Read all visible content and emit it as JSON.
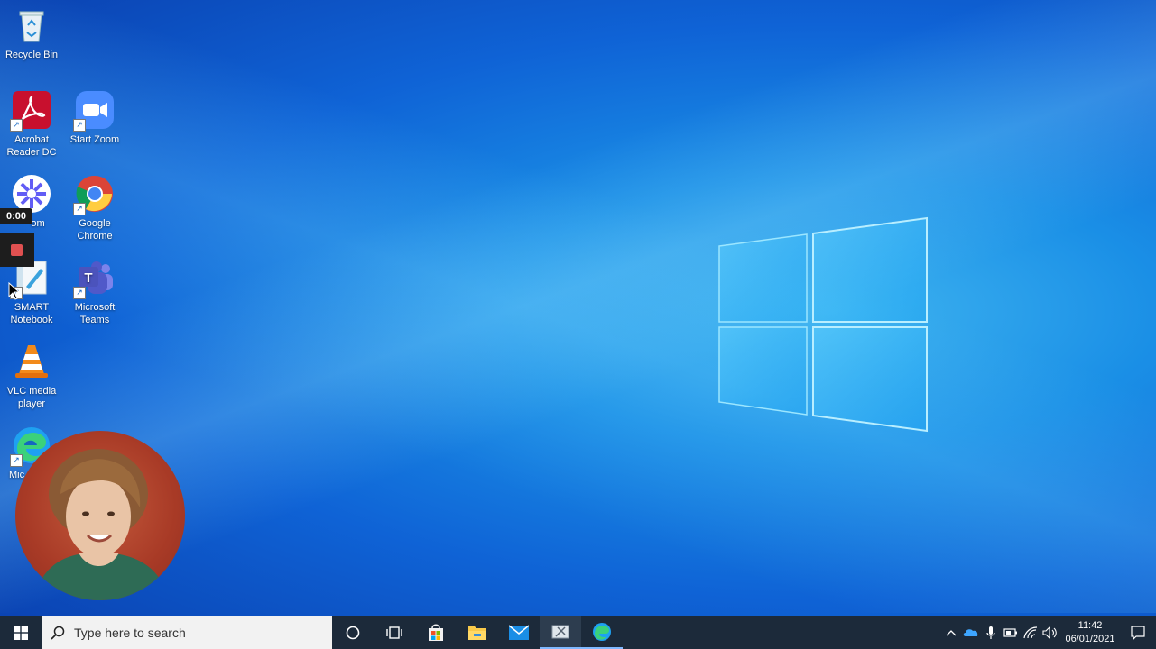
{
  "desktop": {
    "icons": [
      {
        "label": "Recycle Bin",
        "icon": "recycle-bin-icon"
      },
      {
        "label": "Acrobat Reader DC",
        "icon": "acrobat-icon"
      },
      {
        "label": "Start Zoom",
        "icon": "zoom-icon"
      },
      {
        "label": "Loom",
        "icon": "loom-icon"
      },
      {
        "label": "Google Chrome",
        "icon": "chrome-icon"
      },
      {
        "label": "SMART Notebook",
        "icon": "smart-notebook-icon"
      },
      {
        "label": "Microsoft Teams",
        "icon": "teams-icon"
      },
      {
        "label": "VLC media player",
        "icon": "vlc-icon"
      },
      {
        "label": "Mic",
        "icon": "edge-icon"
      }
    ],
    "loom_label_visible": "om"
  },
  "recorder": {
    "time": "0:00",
    "stop_color": "#e05050"
  },
  "taskbar": {
    "search_placeholder": "Type here to search",
    "apps": [
      "cortana-icon",
      "task-view-icon",
      "store-icon",
      "file-explorer-icon",
      "mail-icon",
      "snipping-icon",
      "edge-icon"
    ],
    "clock_time": "11:42",
    "clock_date": "06/01/2021"
  },
  "colors": {
    "taskbar": "#1c2a3a",
    "accent": "#1a8fe6"
  }
}
